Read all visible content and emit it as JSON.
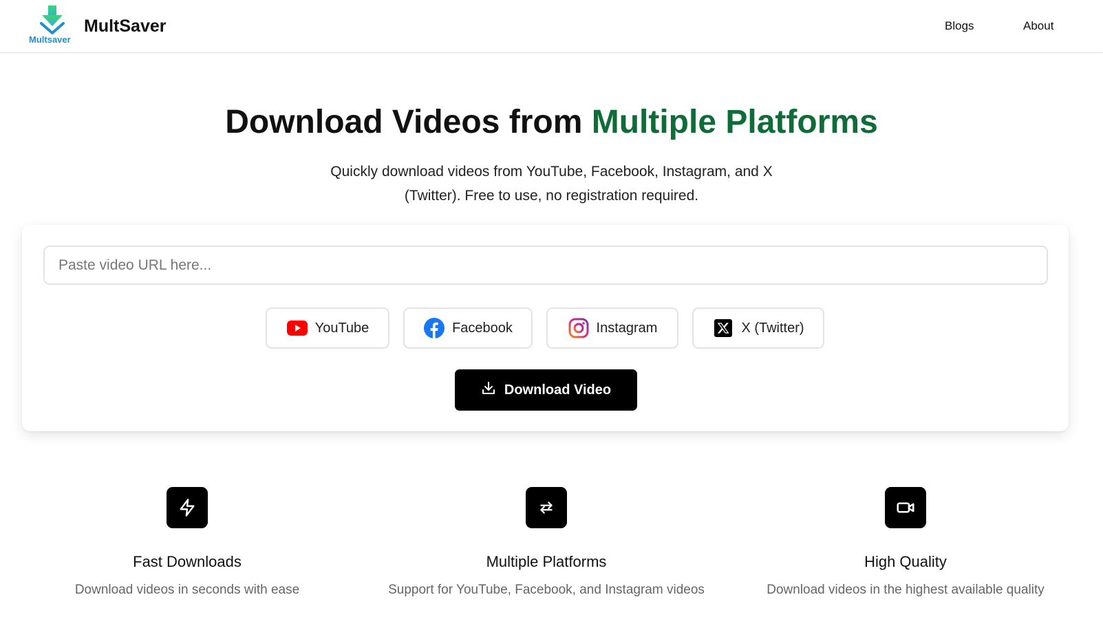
{
  "header": {
    "logo_text": "Multsaver",
    "brand": "MultSaver",
    "nav": {
      "blogs": "Blogs",
      "about": "About"
    }
  },
  "hero": {
    "title_main": "Download Videos from ",
    "title_accent": "Multiple Platforms",
    "subtitle": "Quickly download videos from YouTube, Facebook, Instagram, and X (Twitter). Free to use, no registration required."
  },
  "download_card": {
    "url_placeholder": "Paste video URL here...",
    "platforms": [
      {
        "label": "YouTube",
        "icon": "youtube-icon"
      },
      {
        "label": "Facebook",
        "icon": "facebook-icon"
      },
      {
        "label": "Instagram",
        "icon": "instagram-icon"
      },
      {
        "label": "X (Twitter)",
        "icon": "x-twitter-icon"
      }
    ],
    "download_button": "Download Video"
  },
  "features": [
    {
      "title": "Fast Downloads",
      "description": "Download videos in seconds with ease",
      "icon": "lightning-icon"
    },
    {
      "title": "Multiple Platforms",
      "description": "Support for YouTube, Facebook, and Instagram videos",
      "icon": "swap-arrows-icon"
    },
    {
      "title": "High Quality",
      "description": "Download videos in the highest available quality",
      "icon": "video-camera-icon"
    }
  ],
  "colors": {
    "accent_green": "#0f6b37",
    "button_black": "#000000",
    "logo_blue": "#1e8fd6",
    "logo_green": "#3ed17a"
  }
}
